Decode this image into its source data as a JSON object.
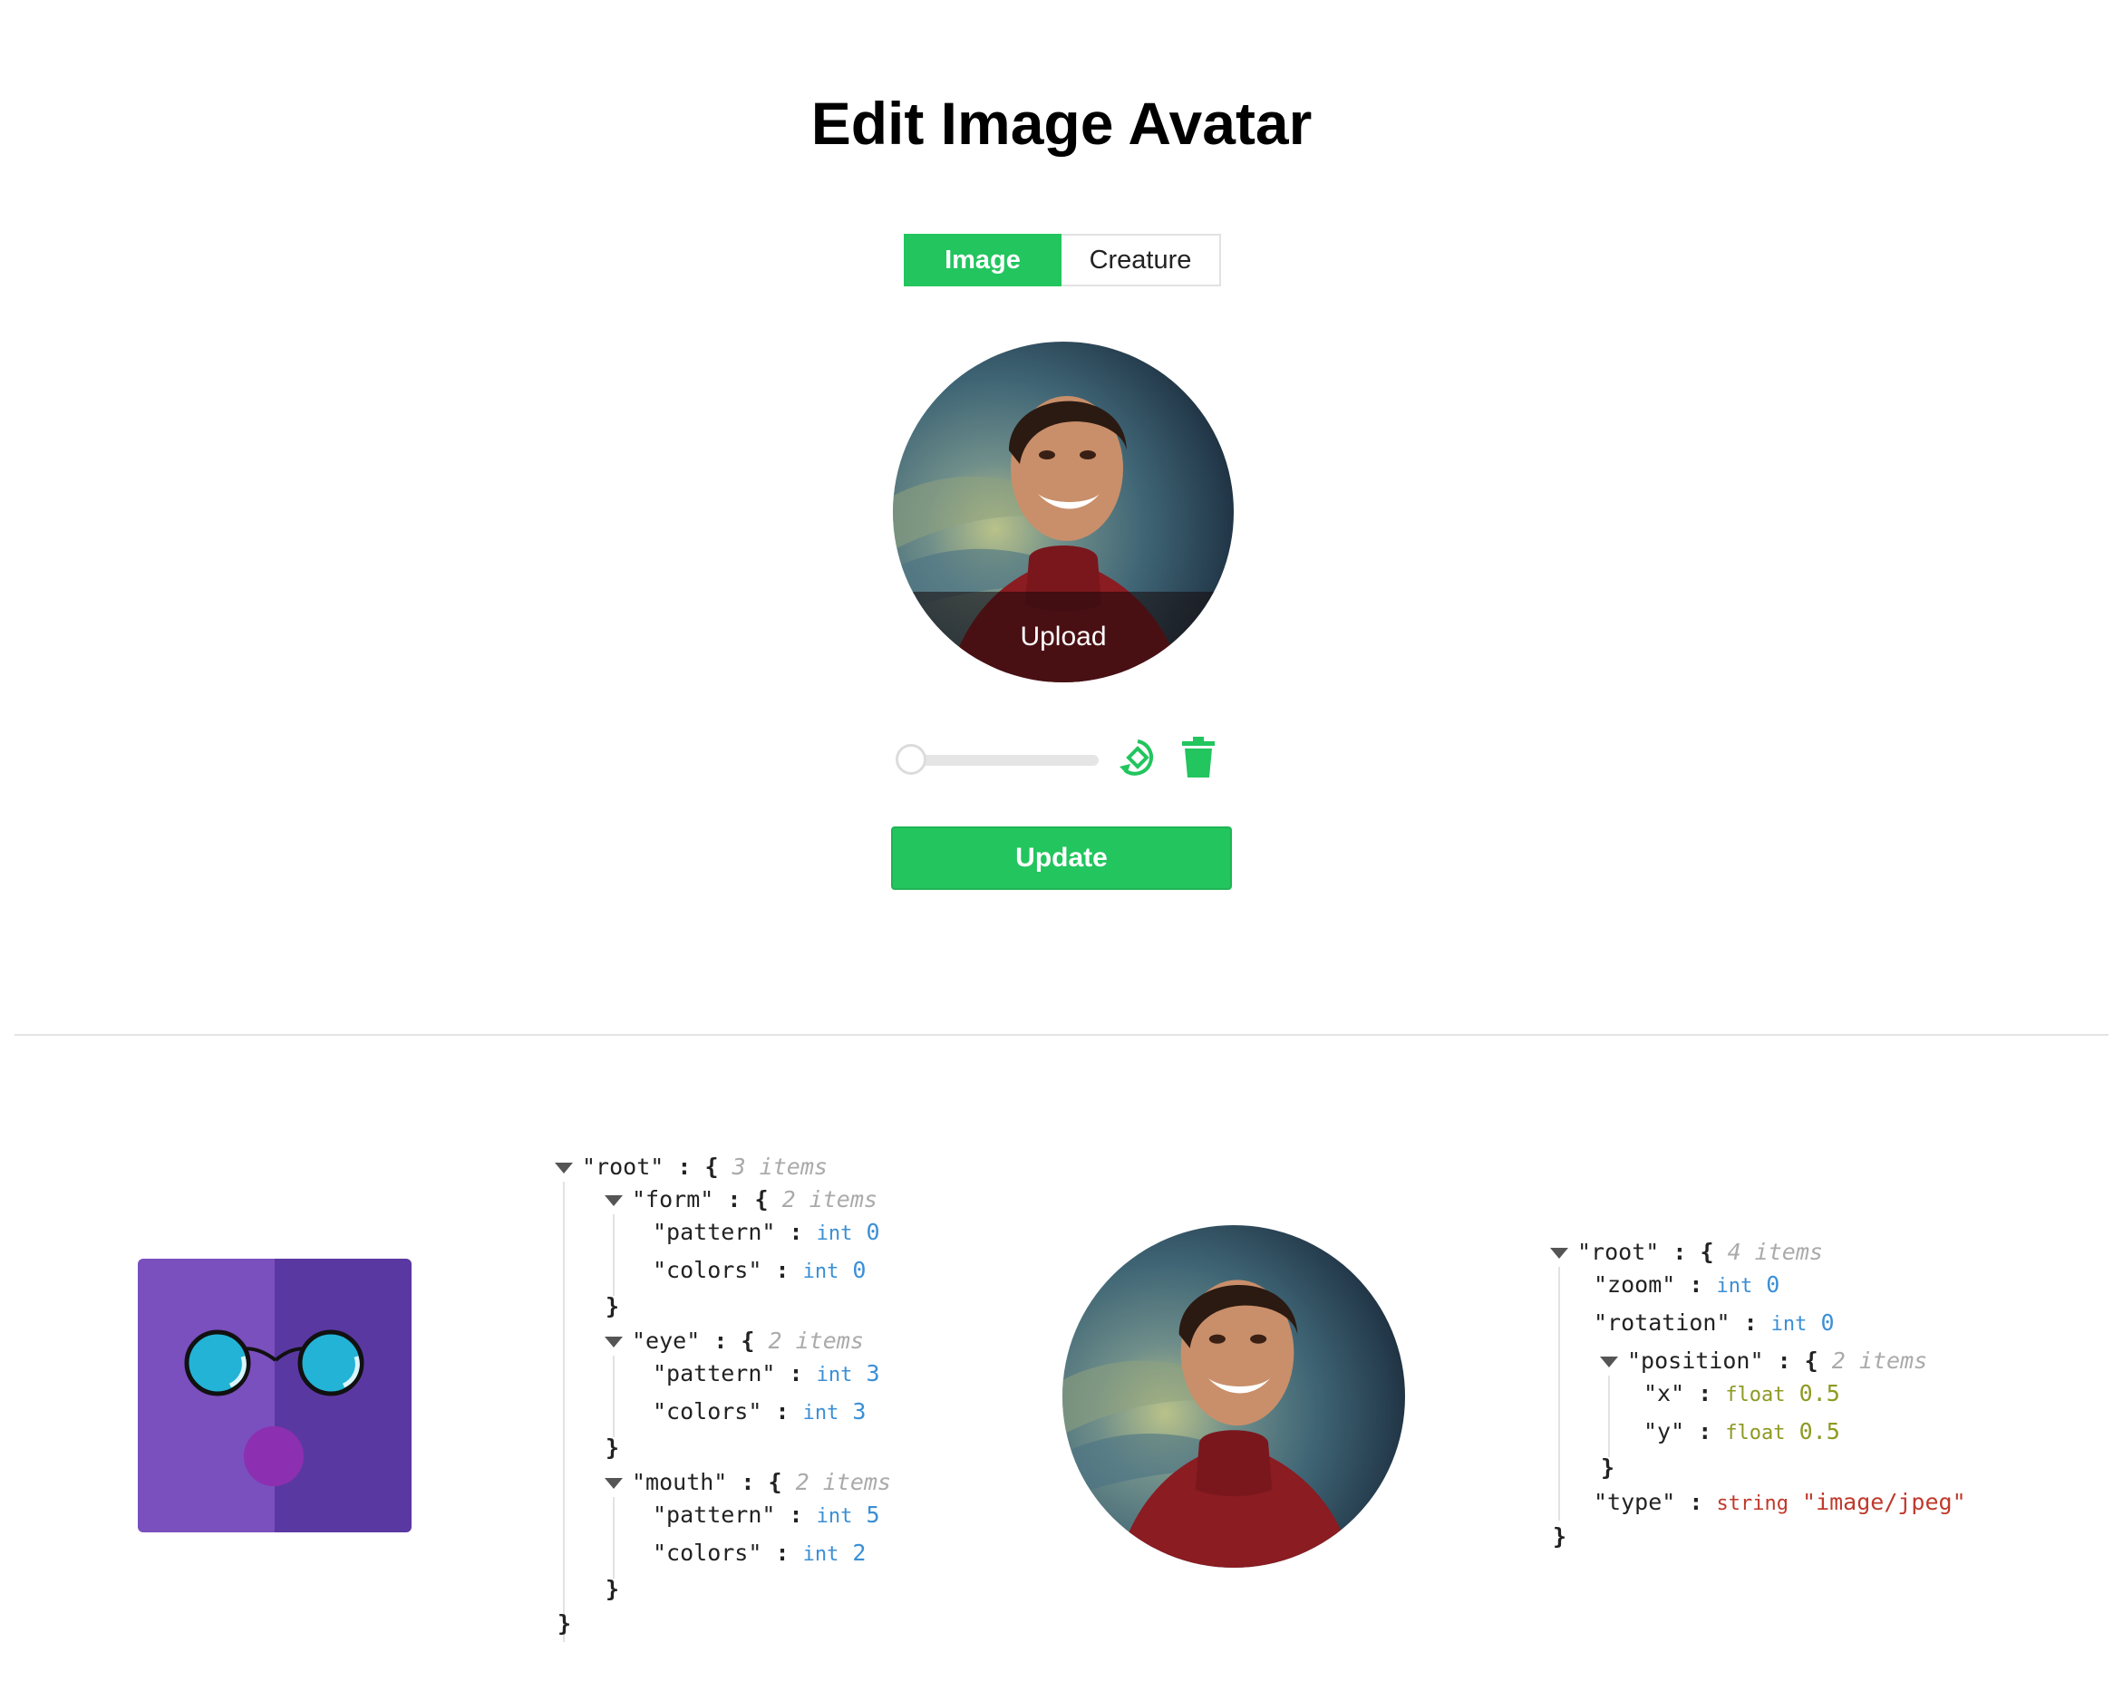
{
  "page": {
    "title": "Edit Image Avatar"
  },
  "tabs": {
    "image_label": "Image",
    "creature_label": "Creature",
    "active": "Image"
  },
  "avatar": {
    "upload_label": "Upload"
  },
  "controls": {
    "zoom_level": 0,
    "update_label": "Update"
  },
  "icons": {
    "rotate": "rotate-icon",
    "delete": "trash-icon"
  },
  "colors": {
    "accent": "#22c55e",
    "creature_left": "#7a4fbe",
    "creature_right": "#5a38a2",
    "glasses": "#23b3d6",
    "mouth": "#8c2fb0"
  },
  "creature_json": {
    "root_key": "\"root\"",
    "root_count": "3 items",
    "form_key": "\"form\"",
    "form_count": "2 items",
    "form_pattern_key": "\"pattern\"",
    "form_pattern_type": "int",
    "form_pattern_value": "0",
    "form_colors_key": "\"colors\"",
    "form_colors_type": "int",
    "form_colors_value": "0",
    "eye_key": "\"eye\"",
    "eye_count": "2 items",
    "eye_pattern_key": "\"pattern\"",
    "eye_pattern_type": "int",
    "eye_pattern_value": "3",
    "eye_colors_key": "\"colors\"",
    "eye_colors_type": "int",
    "eye_colors_value": "3",
    "mouth_key": "\"mouth\"",
    "mouth_count": "2 items",
    "mouth_pattern_key": "\"pattern\"",
    "mouth_pattern_type": "int",
    "mouth_pattern_value": "5",
    "mouth_colors_key": "\"colors\"",
    "mouth_colors_type": "int",
    "mouth_colors_value": "2"
  },
  "image_json": {
    "root_key": "\"root\"",
    "root_count": "4 items",
    "zoom_key": "\"zoom\"",
    "zoom_type": "int",
    "zoom_value": "0",
    "rotation_key": "\"rotation\"",
    "rotation_type": "int",
    "rotation_value": "0",
    "position_key": "\"position\"",
    "position_count": "2 items",
    "x_key": "\"x\"",
    "x_type": "float",
    "x_value": "0.5",
    "y_key": "\"y\"",
    "y_type": "float",
    "y_value": "0.5",
    "type_key": "\"type\"",
    "type_type": "string",
    "type_value": "\"image/jpeg\""
  }
}
